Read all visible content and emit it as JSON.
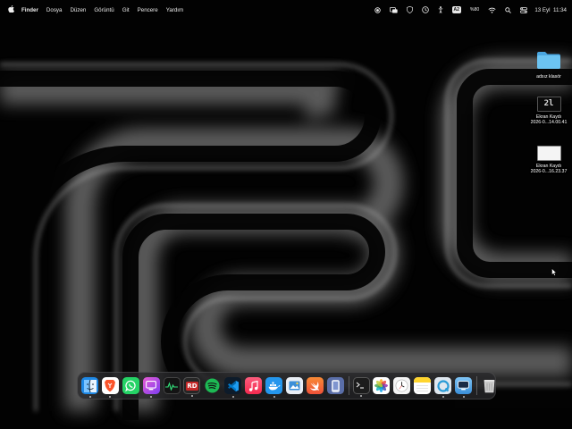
{
  "menubar": {
    "apple_icon": "apple-icon",
    "app_name": "Finder",
    "menus": [
      "Dosya",
      "Düzen",
      "Görüntü",
      "Git",
      "Pencere",
      "Yardım"
    ],
    "status_icons": [
      "record-icon",
      "screen-mirror-icon",
      "shield-icon",
      "clock-icon",
      "figure-icon"
    ],
    "keyboard_badge": "A2",
    "network_speed": "%80",
    "wifi_icon": "wifi-icon",
    "search_icon": "search-icon",
    "control_center_icon": "control-center-icon",
    "date": "13 Eyl",
    "time": "11:34"
  },
  "desktop": {
    "folder": {
      "label": "adsız klasör",
      "icon": "folder-icon",
      "color": "#5eb8ec"
    },
    "file1": {
      "name": "Ekran Kaydı",
      "date": "2026-0...14.00.41",
      "thumb_text": "2l"
    },
    "file2": {
      "name": "Ekran Kaydı",
      "date": "2026-0...16.23.37"
    }
  },
  "dock": {
    "apps": [
      {
        "name": "Finder",
        "icon": "finder-icon",
        "color": "#1e88e5",
        "running": true
      },
      {
        "name": "Brave",
        "icon": "brave-icon",
        "color": "#fb542b",
        "running": true
      },
      {
        "name": "WhatsApp",
        "icon": "whatsapp-icon",
        "color": "#25d366",
        "running": false
      },
      {
        "name": "Screen Studio",
        "icon": "screen-studio-icon",
        "color": "#b94bd6",
        "running": true
      },
      {
        "name": "Activity Monitor",
        "icon": "activity-monitor-icon",
        "color": "#1a1a1a",
        "running": false
      },
      {
        "name": "RD",
        "icon": "rd-client-icon",
        "color": "#222222",
        "running": true
      },
      {
        "name": "Spotify",
        "icon": "spotify-icon",
        "color": "#1db954",
        "running": false
      },
      {
        "name": "VS Code",
        "icon": "vscode-icon",
        "color": "#0a4d7a",
        "running": true
      },
      {
        "name": "Music",
        "icon": "music-icon",
        "color": "#fa2d48",
        "running": false
      },
      {
        "name": "Docker",
        "icon": "docker-icon",
        "color": "#2496ed",
        "running": true
      },
      {
        "name": "Preview",
        "icon": "preview-icon",
        "color": "#3c8fd8",
        "running": false
      },
      {
        "name": "Swift",
        "icon": "swift-icon",
        "color": "#f05138",
        "running": false
      },
      {
        "name": "Simulator",
        "icon": "simulator-icon",
        "color": "#5a6ea8",
        "running": false
      },
      {
        "name": "Terminal",
        "icon": "terminal-icon",
        "color": "#1c1c1c",
        "running": true
      },
      {
        "name": "Photos",
        "icon": "photos-icon",
        "color": "#ffffff",
        "running": false
      },
      {
        "name": "Clock",
        "icon": "clock-app-icon",
        "color": "#f2f2f2",
        "running": false
      },
      {
        "name": "Notes",
        "icon": "notes-icon",
        "color": "#ffd52e",
        "running": false
      },
      {
        "name": "QuickTime",
        "icon": "quicktime-icon",
        "color": "#2a9bd6",
        "running": true
      },
      {
        "name": "Screen Sharing",
        "icon": "screen-sharing-icon",
        "color": "#4aa3e8",
        "running": true
      },
      {
        "name": "Trash",
        "icon": "trash-icon",
        "color": "#9a9a9a",
        "running": false
      }
    ]
  }
}
